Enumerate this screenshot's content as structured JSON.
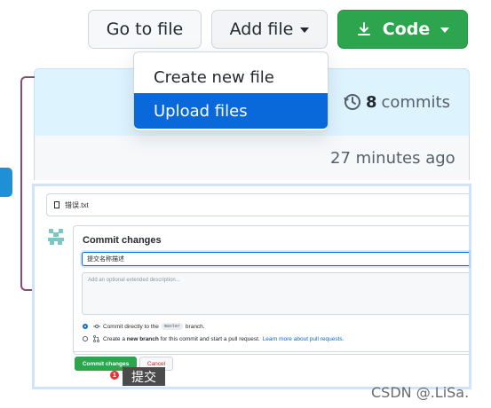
{
  "toolbar": {
    "go_to_file": "Go to file",
    "add_file": "Add file",
    "code": "Code"
  },
  "add_file_menu": {
    "items": [
      {
        "label": "Create new file"
      },
      {
        "label": "Upload files",
        "highlighted": true
      }
    ]
  },
  "repo": {
    "commit_count": "8",
    "commits_label": "commits",
    "last_updated": "27 minutes ago"
  },
  "upload_form": {
    "file_name": "错误.txt",
    "commit_heading": "Commit changes",
    "commit_title_value": "提交名称描述",
    "description_placeholder": "Add an optional extended description...",
    "option_direct": {
      "prefix": "Commit directly to the",
      "branch": "master",
      "suffix": "branch."
    },
    "option_new_branch": {
      "prefix": "Create a",
      "bold": "new branch",
      "suffix": "for this commit and start a pull request.",
      "link": "Learn more about pull requests."
    },
    "commit_button": "Commit changes",
    "cancel_button": "Cancel"
  },
  "annotation": {
    "number": "1",
    "label": "提交"
  },
  "watermark": "CSDN @.LiSa.",
  "colors": {
    "primary_green": "#2da44e",
    "accent_blue": "#0969da",
    "bracket": "#8a4a77",
    "marker": "#1f8fd6"
  }
}
